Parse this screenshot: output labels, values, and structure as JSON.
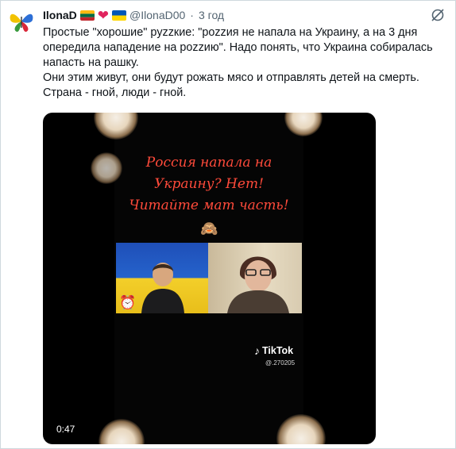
{
  "user": {
    "display_name": "IlonaD",
    "handle": "@IlonaD00",
    "separator": "·",
    "time_ago": "3 год",
    "avatar_icon": "butterfly-icon",
    "name_emojis": [
      "lithuania-flag-icon",
      "red-heart-icon",
      "ukraine-flag-icon"
    ]
  },
  "tweet": {
    "paragraph_1": "Простые \"хорошие\" pyzzкие: \"pozzия не напала на Украину, а на 3 дня опередила нападение на pozzию\". Надо понять, что Украина собиралась напасть на рашку.",
    "paragraph_2": "Они этим живут, они будут рожать мясо и отправлять детей на смерть. Страна - гной, люди - гной."
  },
  "video": {
    "caption_lines": [
      "Россия напала на",
      "Украину?  Нет!",
      "Читайте мат часть!"
    ],
    "caption_emoji": "🙈",
    "clock_emoji": "⏰",
    "tiktok_label": "TikTok",
    "tiktok_handle": "@.270205",
    "duration": "0:47"
  },
  "colors": {
    "caption_red": "#ff4a3a",
    "secondary_text": "#536471",
    "border": "#cfd9de"
  }
}
